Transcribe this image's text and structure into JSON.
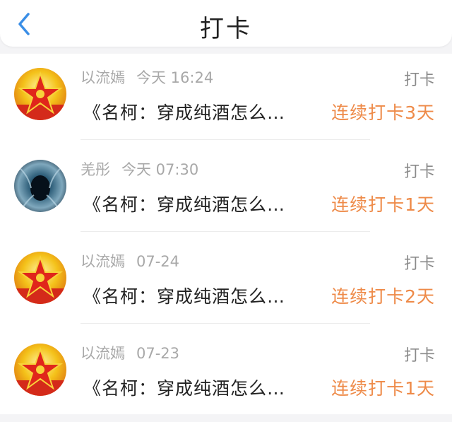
{
  "header": {
    "title": "打卡",
    "back_icon": "chevron-left-icon",
    "accent": "#3a8ee6"
  },
  "records": [
    {
      "user": "以流嫣",
      "time": "今天 16:24",
      "tag": "打卡",
      "book": "《名柯：穿成纯酒怎么…",
      "streak": "连续打卡3天",
      "avatar": "red-star-emblem"
    },
    {
      "user": "羌彤",
      "time": "今天 07:30",
      "tag": "打卡",
      "book": "《名柯：穿成纯酒怎么…",
      "streak": "连续打卡1天",
      "avatar": "blue-tunnel-photo"
    },
    {
      "user": "以流嫣",
      "time": "07-24",
      "tag": "打卡",
      "book": "《名柯：穿成纯酒怎么…",
      "streak": "连续打卡2天",
      "avatar": "red-star-emblem"
    },
    {
      "user": "以流嫣",
      "time": "07-23",
      "tag": "打卡",
      "book": "《名柯：穿成纯酒怎么…",
      "streak": "连续打卡1天",
      "avatar": "red-star-emblem"
    }
  ],
  "colors": {
    "streak": "#ee8a48",
    "meta": "#a8a8a8",
    "text": "#222222"
  }
}
